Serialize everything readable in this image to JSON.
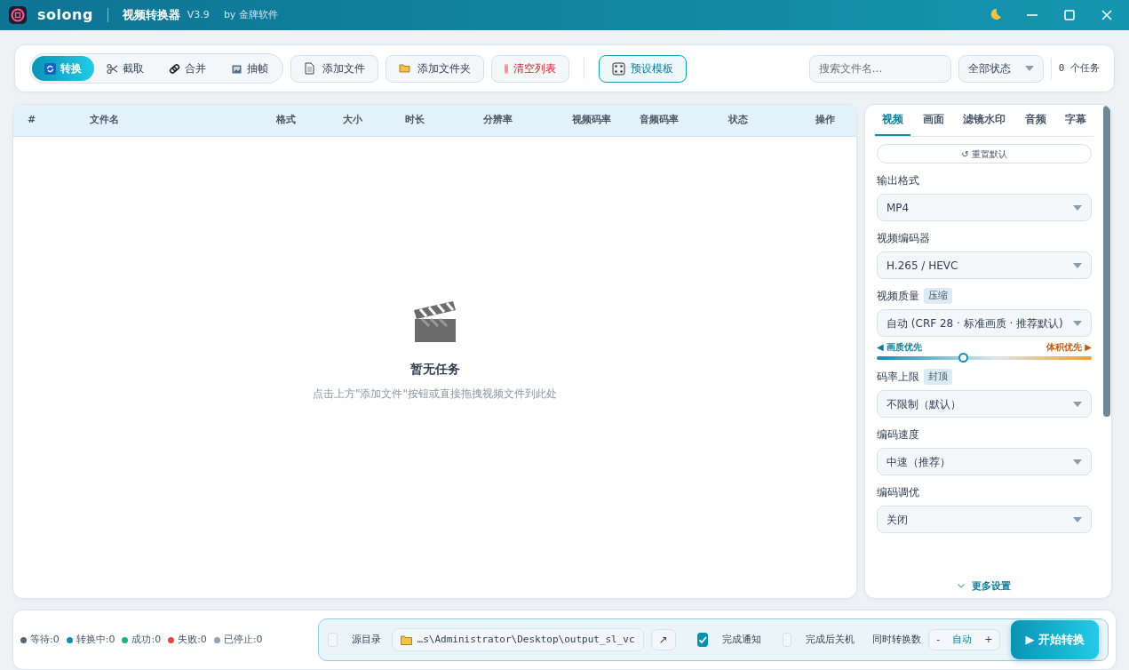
{
  "title_bar": {
    "app_name": "solong",
    "title": "视频转换器",
    "version": "V3.9",
    "vendor": "by 金牌软件"
  },
  "mode_tabs": [
    {
      "label": "转换",
      "kind": "convert",
      "selected": true
    },
    {
      "label": "截取",
      "kind": "cut",
      "selected": false
    },
    {
      "label": "合并",
      "kind": "merge",
      "selected": false
    },
    {
      "label": "抽帧",
      "kind": "frames",
      "selected": false
    }
  ],
  "toolbar_buttons": [
    {
      "label": "添加文件",
      "kind": "file"
    },
    {
      "label": "添加文件夹",
      "kind": "folder"
    },
    {
      "label": "清空列表",
      "kind": "clear"
    },
    {
      "label": "预设模板",
      "kind": "preset"
    }
  ],
  "search": {
    "placeholder": "搜索文件名..."
  },
  "status_filter": {
    "value": "全部状态"
  },
  "task_count": "0 个任务",
  "table": {
    "columns": [
      "#",
      "文件名",
      "格式",
      "大小",
      "时长",
      "分辨率",
      "视频码率",
      "音频码率",
      "状态",
      "操作"
    ]
  },
  "empty_state": {
    "title": "暂无任务",
    "hint": "点击上方\"添加文件\"按钮或直接拖拽视频文件到此处"
  },
  "settings": {
    "tabs": [
      {
        "label": "视频",
        "selected": true
      },
      {
        "label": "画面",
        "selected": false
      },
      {
        "label": "滤镜水印",
        "selected": false
      },
      {
        "label": "音频",
        "selected": false
      },
      {
        "label": "字幕",
        "selected": false
      }
    ],
    "reset_button": "↺ 重置默认",
    "fields": [
      {
        "label": "输出格式",
        "value": "MP4"
      },
      {
        "label": "视频编码器",
        "value": "H.265 / HEVC"
      },
      {
        "label": "视频质量",
        "badge": "压缩",
        "value": "自动 (CRF 28 · 标准画质 · 推荐默认)",
        "slider": {
          "left_label": "◀ 画质优先",
          "right_label": "体积优先 ▶",
          "level": 0.4
        }
      },
      {
        "label": "码率上限",
        "badge": "封顶",
        "value": "不限制（默认）"
      },
      {
        "label": "编码速度",
        "value": "中速（推荐）"
      },
      {
        "label": "编码调优",
        "value": "关闭"
      }
    ],
    "more_button": "更多设置"
  },
  "status_counts": [
    {
      "label": "等待:0",
      "color": "#5b6472"
    },
    {
      "label": "转换中:0",
      "color": "#0e8fb0"
    },
    {
      "label": "成功:0",
      "color": "#19b57a"
    },
    {
      "label": "失败:0",
      "color": "#ef4444"
    },
    {
      "label": "已停止:0",
      "color": "#94a3b8"
    }
  ],
  "output": {
    "source_dir": {
      "label": "源目录",
      "checked": false
    },
    "path": "…s\\Administrator\\Desktop\\output_sl_vc",
    "open_button": "↗",
    "notify": {
      "label": "完成通知",
      "checked": true
    },
    "shutdown": {
      "label": "完成后关机",
      "checked": false
    },
    "concurrency": {
      "label": "同时转换数",
      "minus": "-",
      "value": "自动",
      "plus": "+"
    },
    "start_button": "▶ 开始转换"
  }
}
